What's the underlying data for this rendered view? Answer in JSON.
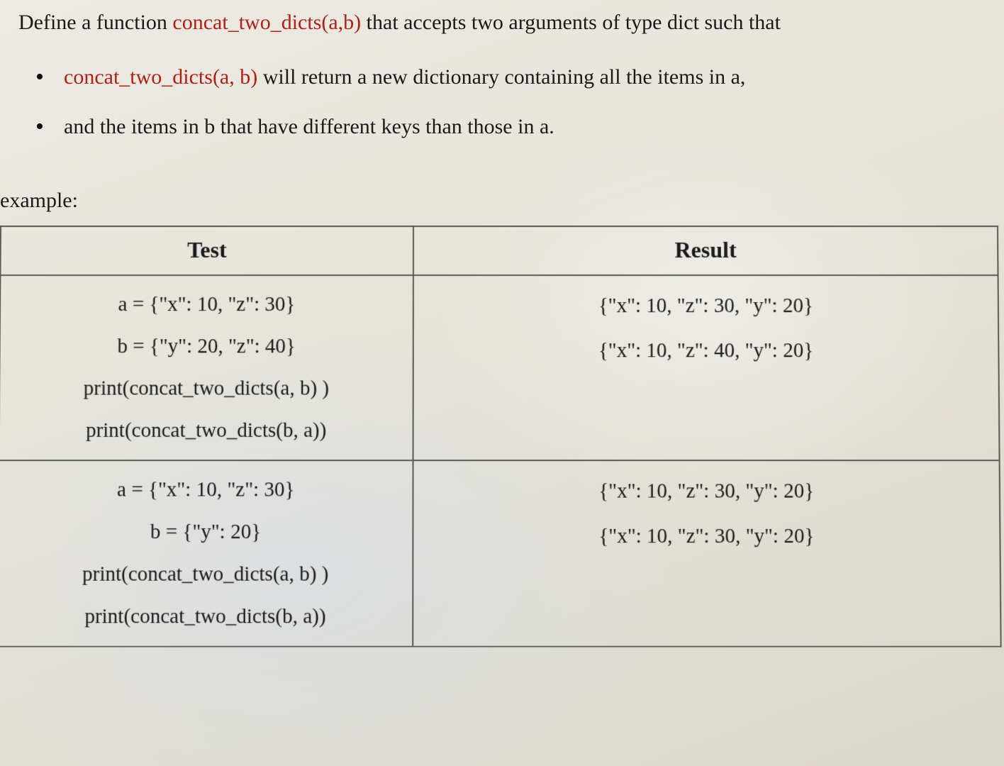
{
  "intro": {
    "prefix": "Define a function ",
    "func": "concat_two_dicts(a,b)",
    "suffix": " that accepts two arguments of type dict such that"
  },
  "bullets": [
    {
      "red": "concat_two_dicts(a, b)",
      "rest": " will return a new dictionary containing all the items in a,"
    },
    {
      "red_inline_prefix": "and the items in ",
      "red_inline_mid": "b",
      "red_inline_suffix": " that have different keys than those in a."
    }
  ],
  "example_label": "example:",
  "table": {
    "headers": {
      "test": "Test",
      "result": "Result"
    },
    "rows": [
      {
        "test": [
          "a = {\"x\": 10, \"z\": 30}",
          "b = {\"y\": 20, \"z\": 40}",
          "print(concat_two_dicts(a, b) )",
          "print(concat_two_dicts(b, a))"
        ],
        "result": [
          "{\"x\": 10, \"z\": 30, \"y\": 20}",
          "{\"x\": 10, \"z\": 40, \"y\": 20}"
        ]
      },
      {
        "test": [
          "a = {\"x\": 10, \"z\": 30}",
          "b = {\"y\": 20}",
          "print(concat_two_dicts(a, b) )",
          "print(concat_two_dicts(b, a))"
        ],
        "result": [
          "{\"x\": 10, \"z\": 30, \"y\": 20}",
          "{\"x\": 10, \"z\": 30, \"y\": 20}"
        ]
      }
    ]
  }
}
